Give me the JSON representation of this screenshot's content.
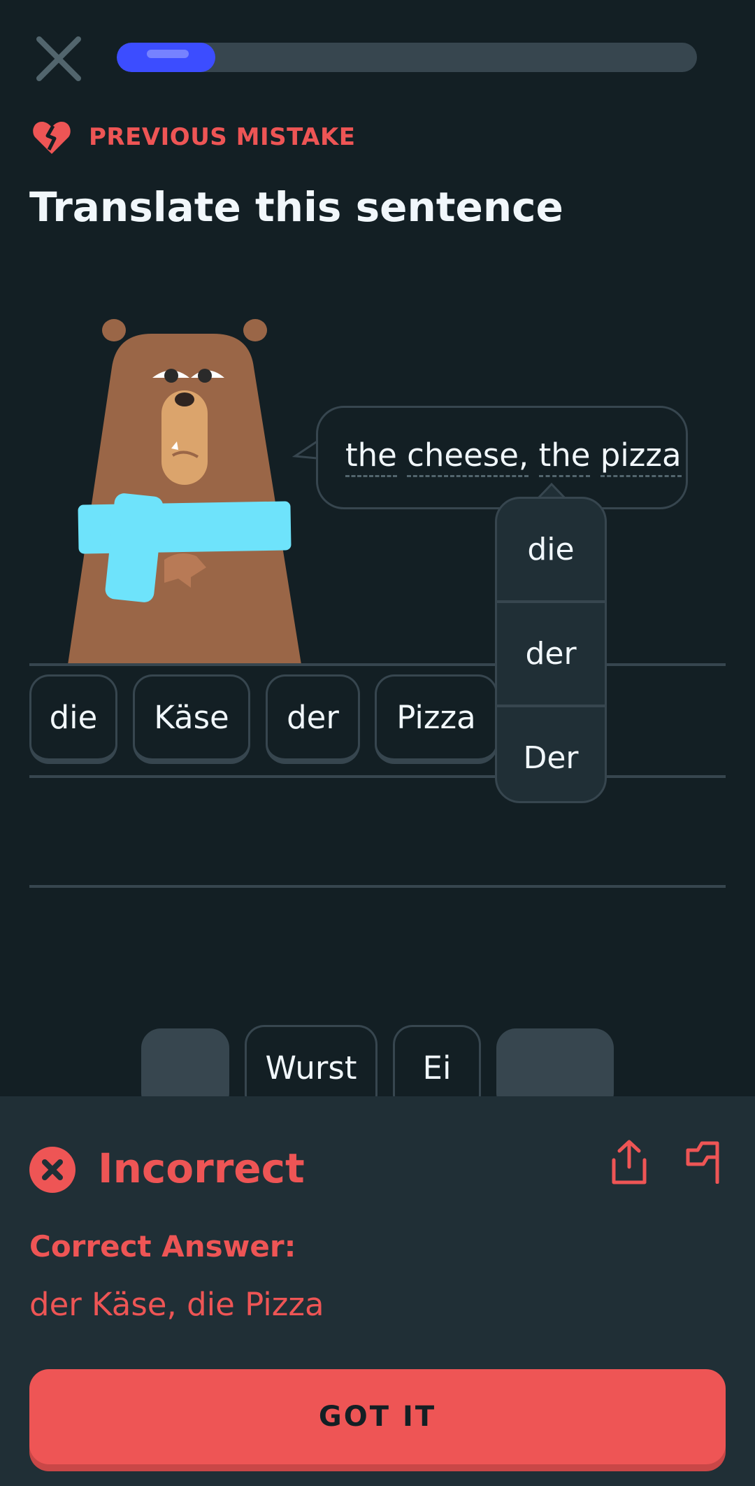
{
  "header": {
    "close_icon": "close-x-icon",
    "progress_percent": 17
  },
  "notice": {
    "icon": "broken-heart-icon",
    "label": "PREVIOUS MISTAKE"
  },
  "prompt": {
    "title": "Translate this sentence"
  },
  "speech": {
    "words": [
      "the",
      "cheese,",
      "the",
      "pizza"
    ]
  },
  "hint": {
    "options": [
      "die",
      "der",
      "Der"
    ]
  },
  "answer_tiles": [
    "die",
    "Käse",
    "der",
    "Pizza"
  ],
  "word_bank": [
    "",
    "Wurst",
    "Ei",
    ""
  ],
  "feedback": {
    "status": "Incorrect",
    "correct_answer_label": "Correct Answer:",
    "correct_answer": "der Käse, die Pizza",
    "button_label": "GOT IT",
    "share_icon": "share-icon",
    "report_icon": "flag-icon"
  },
  "colors": {
    "background": "#131f24",
    "error": "#ee5555",
    "progress": "#3c4dff",
    "sheet": "#202f36"
  }
}
